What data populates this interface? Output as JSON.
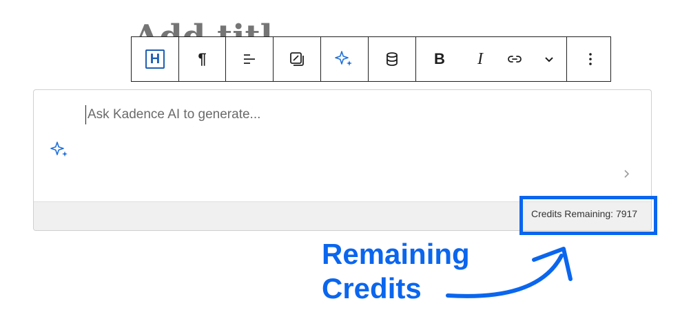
{
  "page": {
    "title": "Add title"
  },
  "toolbar": {
    "heading_icon_text": "H",
    "paragraph_symbol": "¶",
    "bold_label": "B",
    "italic_label": "I"
  },
  "ai_panel": {
    "placeholder": "Ask Kadence AI to generate...",
    "credits_text": "Credits Remaining: 7917"
  },
  "annotation": {
    "line1": "Remaining",
    "line2": "Credits"
  },
  "colors": {
    "accent_blue": "#0a66ee",
    "heading_blue": "#1e5fb3",
    "sparkle_blue": "#1e6fd9"
  }
}
